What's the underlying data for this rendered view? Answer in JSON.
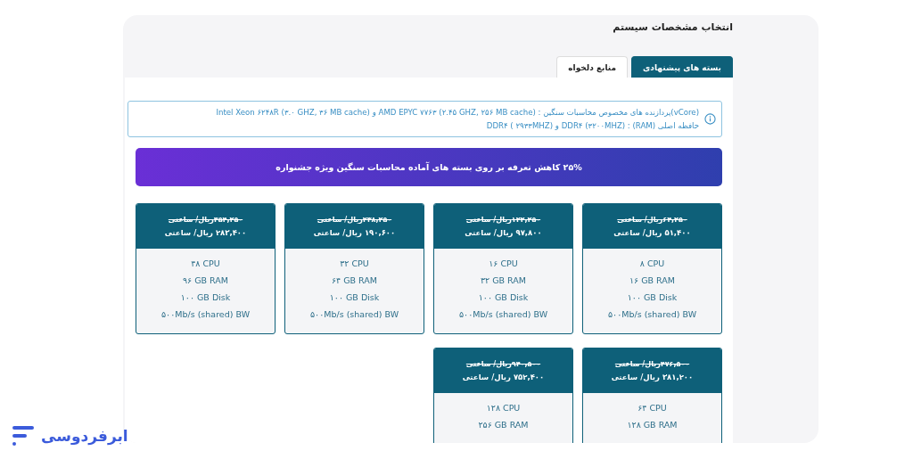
{
  "title": "انتخاب مشخصات سیستم",
  "tabs": [
    {
      "label": "بسته های پیشنهادی",
      "selected": true
    },
    {
      "label": "منابع دلخواه",
      "selected": false
    }
  ],
  "info": {
    "lines": [
      "(vCore)پردازنده های مخصوص محاسبات سنگین : (AMD EPYC ۷۷۶۳ (۲.۴۵ GHZ, ۲۵۶ MB cache و (Intel Xeon ۶۲۴۸R (۳.۰ GHZ, ۳۶ MB cache",
      "حافظه اصلی (RAM) : (DDR۴ (۳۲۰۰MHZ و (DDR۴ ( ۲۹۳۳MHZ"
    ]
  },
  "banner": "۲۵% کاهش تعرفه بر روی بسته های آماده محاسبات سنگین ویژه جشنواره",
  "packages": [
    {
      "old_price": "۶۴,۲۵۰ریال/ ساعتی",
      "price": "۵۱,۴۰۰ ریال/ ساعتی",
      "specs": [
        "۸ CPU",
        "۱۶ GB RAM",
        "۱۰۰ GB Disk",
        "۵۰۰Mb/s (shared) BW"
      ]
    },
    {
      "old_price": "۱۲۲,۲۵۰ریال/ ساعتی",
      "price": "۹۷,۸۰۰ ریال/ ساعتی",
      "specs": [
        "۱۶ CPU",
        "۳۲ GB RAM",
        "۱۰۰ GB Disk",
        "۵۰۰Mb/s (shared) BW"
      ]
    },
    {
      "old_price": "۲۳۸,۲۵۰ریال/ ساعتی",
      "price": "۱۹۰,۶۰۰ ریال/ ساعتی",
      "specs": [
        "۳۲ CPU",
        "۶۴ GB RAM",
        "۱۰۰ GB Disk",
        "۵۰۰Mb/s (shared) BW"
      ]
    },
    {
      "old_price": "۳۵۴,۲۵۰ریال/ ساعتی",
      "price": "۲۸۳,۴۰۰ ریال/ ساعتی",
      "specs": [
        "۴۸ CPU",
        "۹۶ GB RAM",
        "۱۰۰ GB Disk",
        "۵۰۰Mb/s (shared) BW"
      ]
    },
    {
      "old_price": "۴۷۶,۵۰۰ریال/ ساعتی",
      "price": "۳۸۱,۲۰۰ ریال/ ساعتی",
      "specs": [
        "۶۴ CPU",
        "۱۲۸ GB RAM"
      ]
    },
    {
      "old_price": "۹۴۰,۵۰۰ریال/ ساعتی",
      "price": "۷۵۲,۴۰۰ ریال/ ساعتی",
      "specs": [
        "۱۲۸ CPU",
        "۲۵۶ GB RAM"
      ]
    }
  ],
  "logo": {
    "name": "ابرفردوسی"
  }
}
